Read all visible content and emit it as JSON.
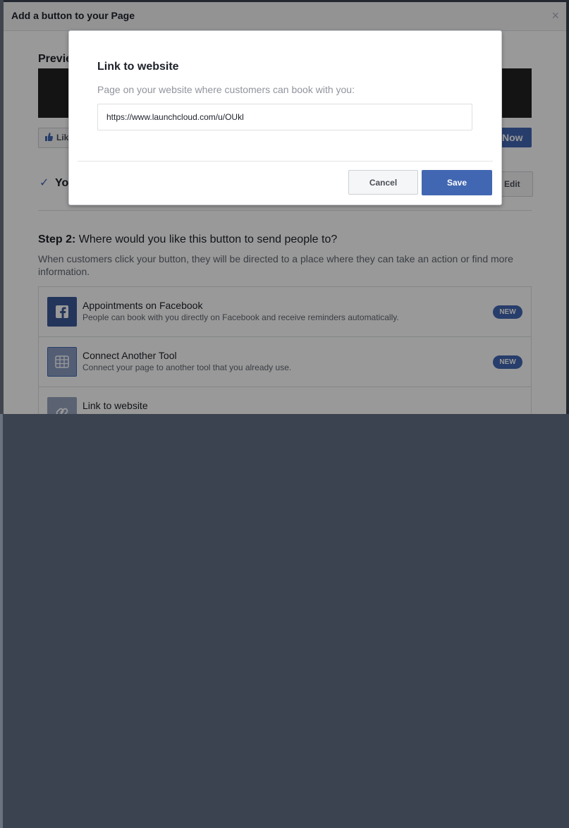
{
  "main_dialog": {
    "title": "Add a button to your Page",
    "close_glyph": "×",
    "preview_label": "Previe",
    "like_label": "Lik",
    "book_now_label": "Now",
    "step1_text": "Yo",
    "edit_label": "Edit",
    "step2_bold": "Step 2:",
    "step2_text": " Where would you like this button to send people to?",
    "step2_desc": "When customers click your button, they will be directed to a place where they can take an action or find more information.",
    "options": [
      {
        "title": "Appointments on Facebook",
        "subtitle": "People can book with you directly on Facebook and receive reminders automatically.",
        "badge": "NEW",
        "icon": "facebook-icon"
      },
      {
        "title": "Connect Another Tool",
        "subtitle": "Connect your page to another tool that you already use.",
        "badge": "NEW",
        "icon": "grid-tool-icon"
      },
      {
        "title": "Link to website",
        "subtitle": "",
        "icon": "link-icon"
      }
    ]
  },
  "modal": {
    "title": "Link to website",
    "label": "Page on your website where customers can book with you:",
    "url_value": "https://www.launchcloud.com/u/OUkl",
    "cancel_label": "Cancel",
    "save_label": "Save"
  },
  "colors": {
    "accent": "#4267b2",
    "facebook_blue": "#3b5998",
    "grid_icon_bg": "#8b9dc3",
    "link_icon_bg": "#98a6bf"
  }
}
